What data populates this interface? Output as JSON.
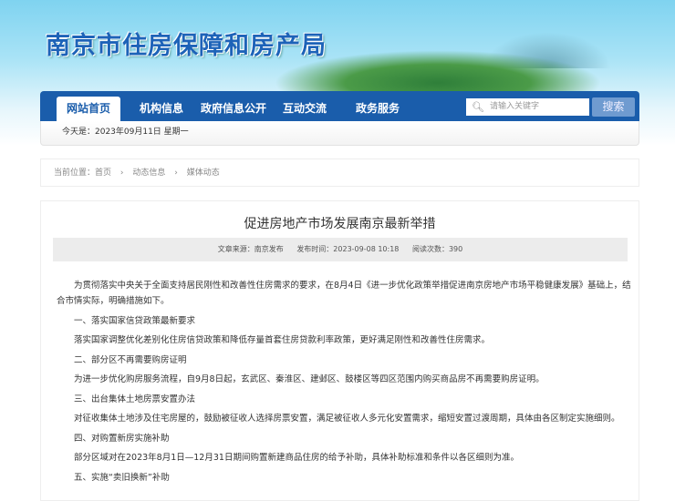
{
  "header": {
    "site_title": "南京市住房保障和房产局"
  },
  "nav": {
    "tabs": [
      {
        "label": "网站首页",
        "active": true
      },
      {
        "label": "机构信息"
      },
      {
        "label": "政府信息公开"
      },
      {
        "label": "互动交流"
      },
      {
        "label": "政务服务"
      }
    ],
    "search_placeholder": "请输入关键字",
    "search_button": "搜索",
    "date_text": "今天是：2023年09月11日 星期一"
  },
  "breadcrumb": {
    "prefix": "当前位置：",
    "items": [
      "首页",
      "动态信息",
      "媒体动态"
    ],
    "separator": "›"
  },
  "article": {
    "title": "促进房地产市场发展南京最新举措",
    "meta": {
      "source": "文章来源：南京发布",
      "time": "发布时间：2023-09-08 10:18",
      "views": "阅读次数：390"
    },
    "paragraphs": [
      "为贯彻落实中央关于全面支持居民刚性和改善性住房需求的要求，在8月4日《进一步优化政策举措促进南京房地产市场平稳健康发展》基础上，结合市情实际，明确措施如下。",
      "一、落实国家信贷政策最新要求",
      "落实国家调整优化差别化住房信贷政策和降低存量首套住房贷款利率政策，更好满足刚性和改善性住房需求。",
      "二、部分区不再需要购房证明",
      "为进一步优化购房服务流程，自9月8日起，玄武区、秦淮区、建邺区、鼓楼区等四区范围内购买商品房不再需要购房证明。",
      "三、出台集体土地房票安置办法",
      "对征收集体土地涉及住宅房屋的，鼓励被征收人选择房票安置，满足被征收人多元化安置需求，缩短安置过渡周期，具体由各区制定实施细则。",
      "四、对购置新房实施补助",
      "部分区域对在2023年8月1日—12月31日期间购置新建商品住房的给予补助，具体补助标准和条件以各区细则为准。",
      "五、实施“卖旧换新”补助"
    ]
  }
}
